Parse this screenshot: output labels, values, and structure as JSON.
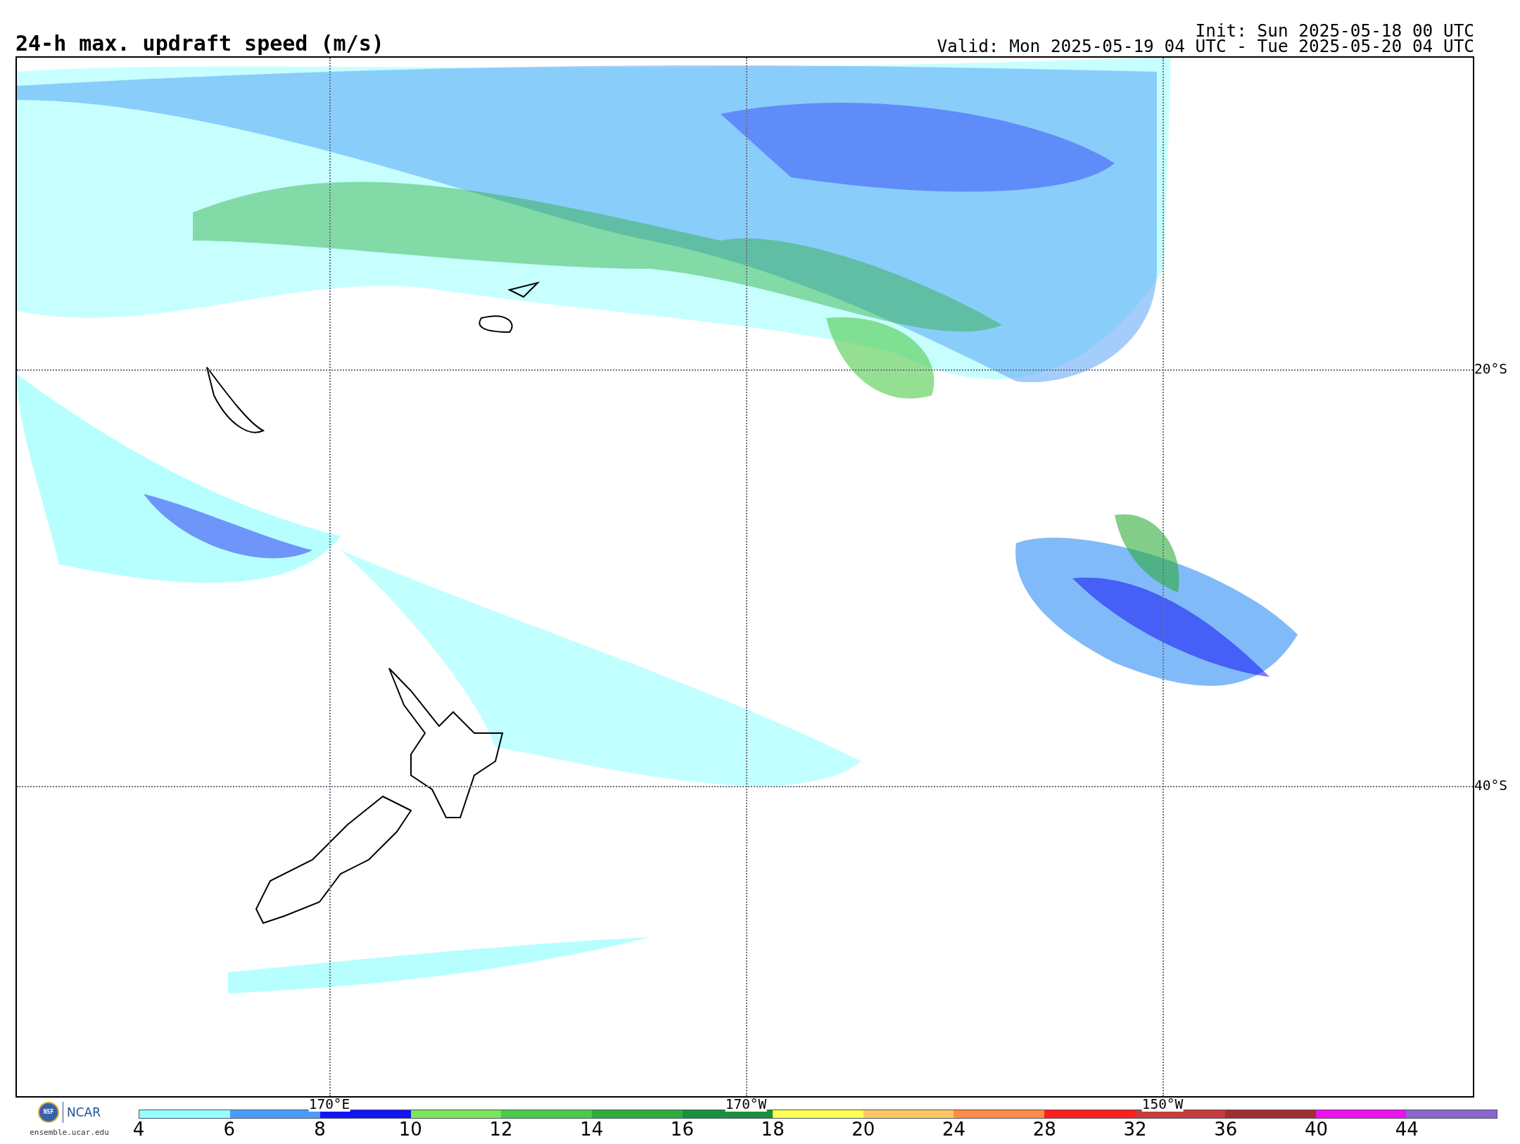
{
  "title": "24-h max. updraft speed (m/s)",
  "init": "Init: Sun 2025-05-18 00 UTC",
  "valid": "Valid: Mon 2025-05-19 04 UTC - Tue 2025-05-20 04 UTC",
  "map": {
    "lat_labels": [
      "20°S",
      "40°S"
    ],
    "lon_labels": [
      "170°E",
      "170°W",
      "150°W"
    ]
  },
  "legend": {
    "bins": [
      {
        "label": "4",
        "color": "#99ffff"
      },
      {
        "label": "6",
        "color": "#4c9cf7"
      },
      {
        "label": "8",
        "color": "#1414f5"
      },
      {
        "label": "10",
        "color": "#7be55a"
      },
      {
        "label": "12",
        "color": "#4ec94a"
      },
      {
        "label": "14",
        "color": "#2fad3a"
      },
      {
        "label": "16",
        "color": "#1b8f3c"
      },
      {
        "label": "18",
        "color": "#ffff55"
      },
      {
        "label": "20",
        "color": "#ffc864"
      },
      {
        "label": "24",
        "color": "#ff8c46"
      },
      {
        "label": "28",
        "color": "#ff1e1e"
      },
      {
        "label": "32",
        "color": "#c83c3c"
      },
      {
        "label": "36",
        "color": "#a0302c"
      },
      {
        "label": "40",
        "color": "#ee10ee"
      },
      {
        "label": "44",
        "color": "#8b66cc"
      }
    ]
  },
  "footer": {
    "seal": "NSF",
    "logo": "NCAR",
    "site": "ensemble.ucar.edu"
  }
}
